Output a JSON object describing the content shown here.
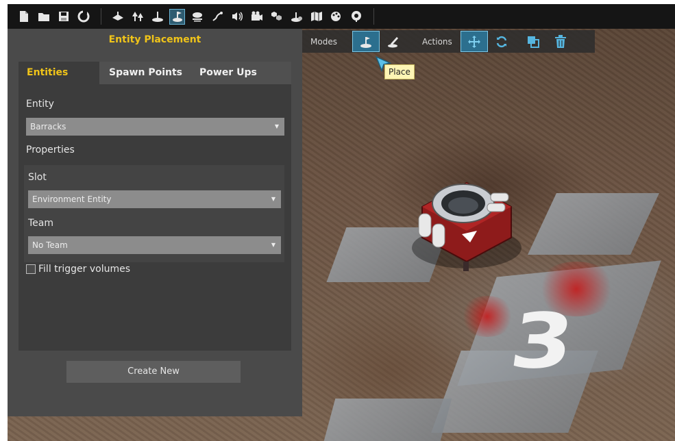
{
  "toolbar": {
    "file_icons": [
      "new-file-icon",
      "open-folder-icon",
      "save-icon",
      "reload-icon"
    ],
    "tool_icons": [
      "terrain-icon",
      "trees-icon",
      "placement-icon",
      "place-entity-icon",
      "clouds-icon",
      "path-icon",
      "sound-icon",
      "camera-icon",
      "objects-icon",
      "entity-icon",
      "map-icon",
      "paint-icon",
      "globe-icon"
    ],
    "active_tool": "place-entity-icon"
  },
  "panel": {
    "title": "Entity Placement",
    "tabs": [
      "Entities",
      "Spawn Points",
      "Power Ups"
    ],
    "active_tab": "Entities",
    "entity_label": "Entity",
    "entity_value": "Barracks",
    "properties_label": "Properties",
    "slot_label": "Slot",
    "slot_value": "Environment Entity",
    "team_label": "Team",
    "team_value": "No Team",
    "fill_trigger_label": "Fill trigger volumes",
    "fill_trigger_checked": false,
    "create_button": "Create New"
  },
  "modes": {
    "modes_label": "Modes",
    "actions_label": "Actions",
    "tooltip": "Place"
  },
  "viewport": {
    "ground_number": "3"
  },
  "colors": {
    "accent_yellow": "#f0c419",
    "active_blue": "#2c6f8e",
    "panel_bg": "#4a4a4a"
  }
}
